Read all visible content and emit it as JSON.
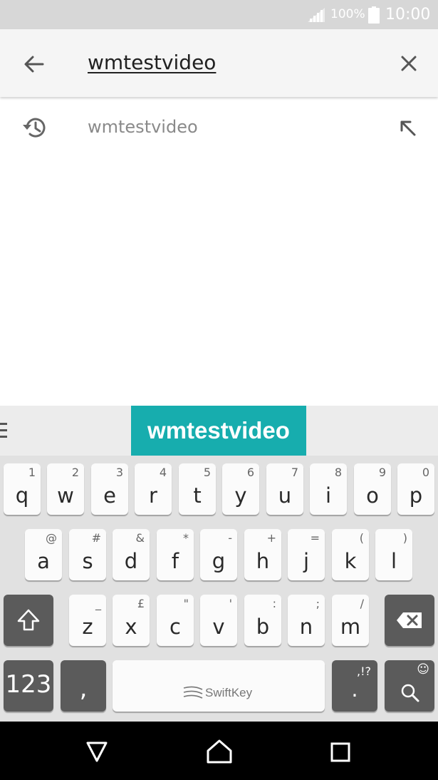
{
  "status_bar": {
    "battery_percent": "100%",
    "time": "10:00"
  },
  "search": {
    "query": "wmtestvideo"
  },
  "suggestions": [
    {
      "text": "wmtestvideo"
    }
  ],
  "keyboard": {
    "prediction": "wmtestvideo",
    "row1": [
      {
        "main": "q",
        "sub": "1"
      },
      {
        "main": "w",
        "sub": "2"
      },
      {
        "main": "e",
        "sub": "3"
      },
      {
        "main": "r",
        "sub": "4"
      },
      {
        "main": "t",
        "sub": "5"
      },
      {
        "main": "y",
        "sub": "6"
      },
      {
        "main": "u",
        "sub": "7"
      },
      {
        "main": "i",
        "sub": "8"
      },
      {
        "main": "o",
        "sub": "9"
      },
      {
        "main": "p",
        "sub": "0"
      }
    ],
    "row2": [
      {
        "main": "a",
        "sub": "@"
      },
      {
        "main": "s",
        "sub": "#"
      },
      {
        "main": "d",
        "sub": "&"
      },
      {
        "main": "f",
        "sub": "*"
      },
      {
        "main": "g",
        "sub": "-"
      },
      {
        "main": "h",
        "sub": "+"
      },
      {
        "main": "j",
        "sub": "="
      },
      {
        "main": "k",
        "sub": "("
      },
      {
        "main": "l",
        "sub": ")"
      }
    ],
    "row3": [
      {
        "main": "z",
        "sub": "_"
      },
      {
        "main": "x",
        "sub": "£"
      },
      {
        "main": "c",
        "sub": "\""
      },
      {
        "main": "v",
        "sub": "'"
      },
      {
        "main": "b",
        "sub": ":"
      },
      {
        "main": "n",
        "sub": ";"
      },
      {
        "main": "m",
        "sub": "/"
      }
    ],
    "numbers_label": "123",
    "comma_label": ",",
    "space_brand": "SwiftKey",
    "period_label": ".",
    "period_sub": ",!?",
    "search_sub": "☺"
  }
}
